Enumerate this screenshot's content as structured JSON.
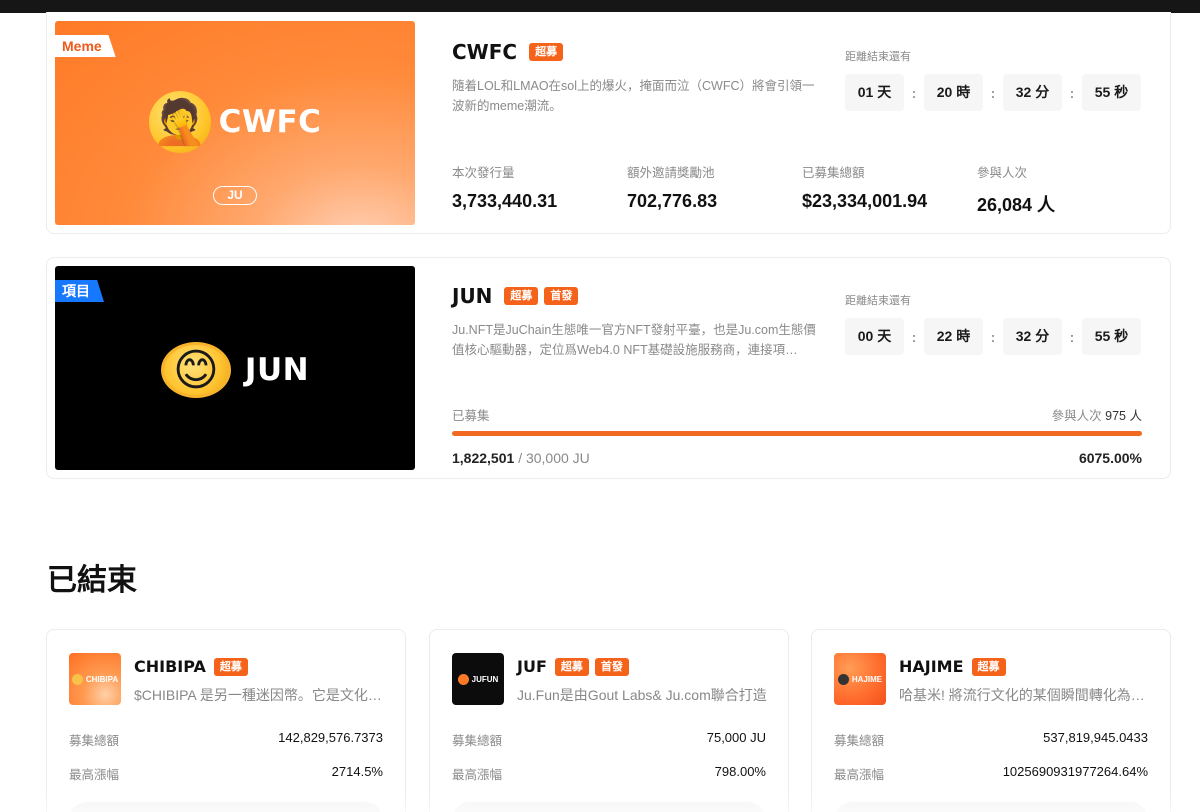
{
  "active": [
    {
      "banner_tag": "Meme",
      "banner_name": "CWFC",
      "banner_currency": "JU",
      "emoji": "🤦",
      "title": "CWFC",
      "badges": [
        "超募"
      ],
      "description": "隨着LOL和LMAO在sol上的爆火，掩面而泣（CWFC）將會引領一波新的meme潮流。",
      "countdown": {
        "label": "距離結束還有",
        "days": "01 天",
        "hours": "20 時",
        "minutes": "32 分",
        "seconds": "55 秒"
      },
      "stats": [
        {
          "label": "本次發行量",
          "value": "3,733,440.31"
        },
        {
          "label": "額外邀請獎勵池",
          "value": "702,776.83"
        },
        {
          "label": "已募集總額",
          "value": "$23,334,001.94"
        },
        {
          "label": "參與人次",
          "value": "26,084 人"
        }
      ]
    },
    {
      "banner_tag": "項目",
      "banner_name": "JUN",
      "emoji": "😊",
      "title": "JUN",
      "badges": [
        "超募",
        "首發"
      ],
      "description": "Ju.NFT是JuChain生態唯一官方NFT發射平臺，也是Ju.com生態價值核心驅動器，定位爲Web4.0 NFT基礎設施服務商，連接項…",
      "countdown": {
        "label": "距離結束還有",
        "days": "00 天",
        "hours": "22 時",
        "minutes": "32 分",
        "seconds": "55 秒"
      },
      "progress": {
        "label": "已募集",
        "participants_label": "參與人次",
        "participants_value": "975 人",
        "raised": "1,822,501",
        "target": "/ 30,000 JU",
        "percent": "6075.00%",
        "fill_fraction": 1.0
      }
    }
  ],
  "ended": {
    "title": "已結束",
    "items": [
      {
        "logo_text": "CHIBIPA",
        "name": "CHIBIPA",
        "badges": [
          "超募"
        ],
        "description": "$CHIBIPA 是另一種迷因幣。它是文化的象徵",
        "rows": [
          {
            "k": "募集總額",
            "v": "142,829,576.7373"
          },
          {
            "k": "最高漲幅",
            "v": "2714.5%"
          }
        ]
      },
      {
        "logo_text": "JUFUN",
        "name": "JUF",
        "badges": [
          "超募",
          "首發"
        ],
        "description": "Ju.Fun是由Gout Labs& Ju.com聯合打造",
        "rows": [
          {
            "k": "募集總額",
            "v": "75,000 JU"
          },
          {
            "k": "最高漲幅",
            "v": "798.00%"
          }
        ]
      },
      {
        "logo_text": "HAJIME",
        "name": "HAJIME",
        "badges": [
          "超募"
        ],
        "description": "哈基米! 將流行文化的某個瞬間轉化為永恆",
        "rows": [
          {
            "k": "募集總額",
            "v": "537,819,945.0433"
          },
          {
            "k": "最高漲幅",
            "v": "1025690931977264.64%"
          }
        ]
      }
    ]
  },
  "colors": {
    "accent": "#f5631a",
    "project_tag": "#1677ff"
  }
}
